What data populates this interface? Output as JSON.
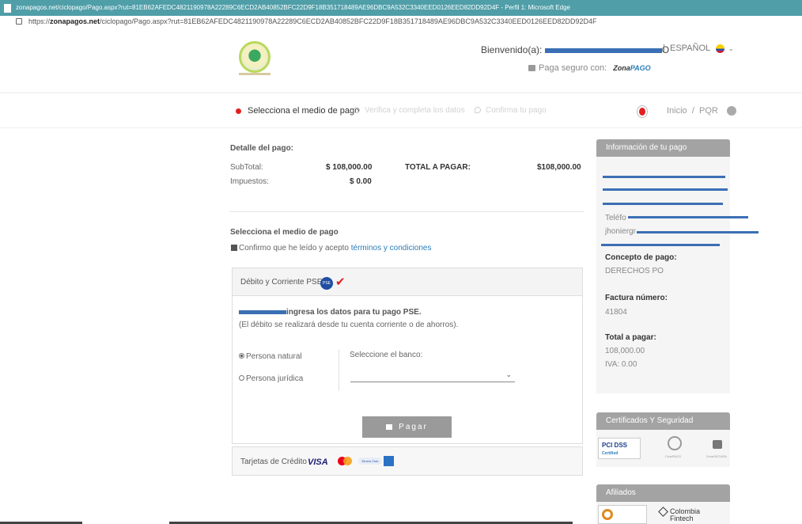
{
  "window": {
    "title": "zonapagos.net/ciclopago/Pago.aspx?rut=81EB62AFEDC4821190978A22289C6ECD2AB40852BFC22D9F18B351718489AE96DBC9A532C3340EED0126EED82DD92D4F - Perfil 1: Microsoft Edge",
    "url_prefix": "https://",
    "url_domain": "zonapagos.net",
    "url_rest": "/ciclopago/Pago.aspx?rut=81EB62AFEDC4821190978A22289C6ECD2AB40852BFC22D9F18B351718489AE96DBC9A532C3340EED0126EED82DD92D4F"
  },
  "header": {
    "welcome_label": "Bienvenido(a):",
    "welcome_tail": "O",
    "separator": "|",
    "language": "ESPAÑOL",
    "secure_label": "Paga seguro con:",
    "zonapago_a": "Zona",
    "zonapago_b": "PAGO"
  },
  "steps": {
    "step1": "Selecciona el medio de pago",
    "step2": "Verifica y completa los datos",
    "step3": "Confirma tu pago",
    "inicio": "Inicio",
    "slash": "/",
    "pqr": "PQR"
  },
  "detail": {
    "title": "Detalle del pago:",
    "subtotal_label": "SubTotal:",
    "subtotal_value": "$ 108,000.00",
    "taxes_label": "Impuestos:",
    "taxes_value": "$ 0.00",
    "total_label": "TOTAL A PAGAR:",
    "total_value": "$108,000.00"
  },
  "payment_method": {
    "title": "Selecciona el medio de pago",
    "terms_prefix": "Confirmo que he leído y acepto",
    "terms_link": "términos y condiciones",
    "pse_title": "Débito y Corriente PSE",
    "pse_logo": "PSE",
    "pse_instruction": "ingresa los datos para tu pago PSE.",
    "pse_note": "(El débito se realizará desde tu cuenta corriente o de ahorros).",
    "person_natural": "Persona natural",
    "person_juridica": "Persona jurídica",
    "bank_label": "Seleccione el banco:",
    "pay_button": "Pagar",
    "cards_title": "Tarjetas de Crédito",
    "visa": "VISA",
    "diners": "Diners Club"
  },
  "info": {
    "title": "Información de tu pago",
    "phone_label": "Teléfo",
    "email_start": "jhoniergr",
    "concept_label": "Concepto de pago:",
    "concept_value": "DERECHOS PO",
    "invoice_label": "Factura número:",
    "invoice_value": "41804",
    "total_label": "Total a pagar:",
    "total_value": "108,000.00",
    "iva": "IVA: 0.00"
  },
  "security": {
    "title": "Certificados Y Seguridad",
    "pci": "PCI DSS",
    "pci_sub": "Certified",
    "ciclo": "CicloPAGO",
    "zona_segura": "ZonaSEGURA"
  },
  "affiliates": {
    "title": "Afiliados",
    "colombia": "Colombia",
    "fintech": "Fintech"
  },
  "colors": {
    "accent": "#2a7db8",
    "error_red": "#e02020",
    "redaction": "#3b6fb4",
    "side_header": "#a3a3a3",
    "titlebar": "#4f9ea8"
  }
}
